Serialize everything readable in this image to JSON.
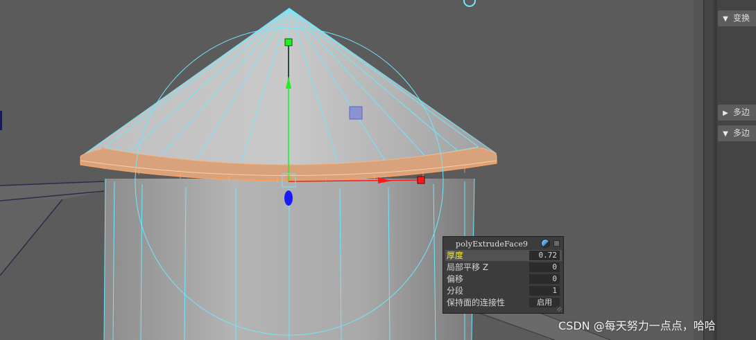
{
  "attribute_editor": {
    "sections": [
      {
        "label": "变换",
        "state": "expanded"
      },
      {
        "label": "多边",
        "state": "collapsed"
      },
      {
        "label": "多边",
        "state": "expanded"
      }
    ]
  },
  "extrude_popup": {
    "title": "polyExtrudeFace9",
    "rows": [
      {
        "label": "厚度",
        "value": "0.72",
        "selected": true
      },
      {
        "label": "局部平移 Z",
        "value": "0"
      },
      {
        "label": "偏移",
        "value": "0"
      },
      {
        "label": "分段",
        "value": "1"
      },
      {
        "label": "保持面的连接性",
        "value": "启用"
      }
    ]
  },
  "watermark": "CSDN @每天努力一点点，哈哈",
  "colors": {
    "viewport_bg": "#5b5b5b",
    "wireframe": "#6fe8ff",
    "selected_face": "#ffb27a",
    "manip_x": "#ff1a1a",
    "manip_y": "#22ee22",
    "manip_z": "#1a1aff",
    "highlight_label": "#f3e93b"
  },
  "icons": [
    "triangle-down-icon",
    "triangle-right-icon",
    "popup-toggle-icon",
    "close-icon",
    "resize-grip-icon"
  ]
}
